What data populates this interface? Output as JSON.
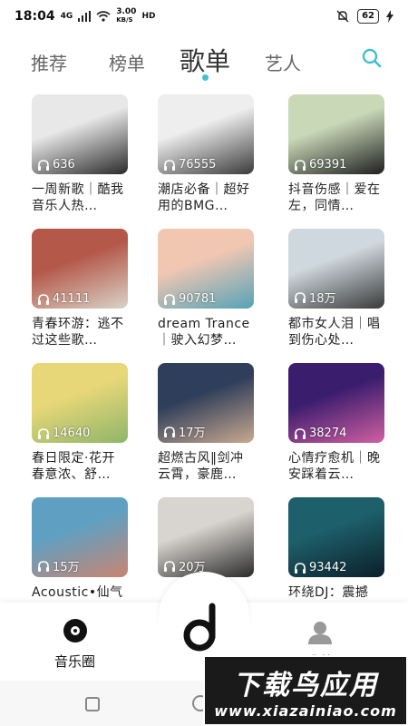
{
  "status_bar": {
    "time": "18:04",
    "signal": "4G",
    "speed_top": "3.00",
    "speed_bottom": "KB/S",
    "hd": "HD",
    "battery": "62"
  },
  "tabs": [
    {
      "label": "推荐"
    },
    {
      "label": "榜单"
    },
    {
      "label": "歌单",
      "active": true
    },
    {
      "label": "艺人"
    }
  ],
  "accent_color": "#3ec1cc",
  "playlists": [
    {
      "count": "636",
      "title": "一周新歌｜酷我音乐人热…",
      "colors": [
        "#e8e8e8",
        "#2a2a2a"
      ]
    },
    {
      "count": "76555",
      "title": "潮店必备｜超好用的BMG…",
      "colors": [
        "#eeeeee",
        "#3b3b3b"
      ]
    },
    {
      "count": "69391",
      "title": "抖音伤感｜爱在左，同情…",
      "colors": [
        "#c9d9b8",
        "#1f1f1f"
      ]
    },
    {
      "count": "41111",
      "title": "青春环游：逃不过这些歌…",
      "colors": [
        "#b4584a",
        "#d9d3c6"
      ]
    },
    {
      "count": "90781",
      "title": "dream Trance｜驶入幻梦…",
      "colors": [
        "#f2c7b2",
        "#54a3b8"
      ]
    },
    {
      "count": "18万",
      "title": "都市女人泪｜唱到伤心处…",
      "colors": [
        "#cfd8de",
        "#3a3a3a"
      ]
    },
    {
      "count": "14640",
      "title": "春日限定·花开春意浓、舒…",
      "colors": [
        "#e8d778",
        "#8fb56a"
      ]
    },
    {
      "count": "17万",
      "title": "超燃古风‖剑冲云霄，豪鹿…",
      "colors": [
        "#2f3e5a",
        "#c9a98f"
      ]
    },
    {
      "count": "38274",
      "title": "心情疗愈机｜晚安踩着云…",
      "colors": [
        "#3b1d6e",
        "#d25fa2"
      ]
    },
    {
      "count": "15万",
      "title": "Acoustic•仙气",
      "colors": [
        "#5fa0c2",
        "#c98572"
      ]
    },
    {
      "count": "20万",
      "title": "",
      "colors": [
        "#d8d4cf",
        "#2b2b2b"
      ]
    },
    {
      "count": "93442",
      "title": "环绕DJ：震撼",
      "colors": [
        "#1d5f6a",
        "#0b1f2a"
      ]
    }
  ],
  "bottom_nav": {
    "music_circle": "音乐圈",
    "mine": "我的"
  },
  "watermark": {
    "line1": "下载鸟应用",
    "line2": "www.xiazainiao.com"
  }
}
